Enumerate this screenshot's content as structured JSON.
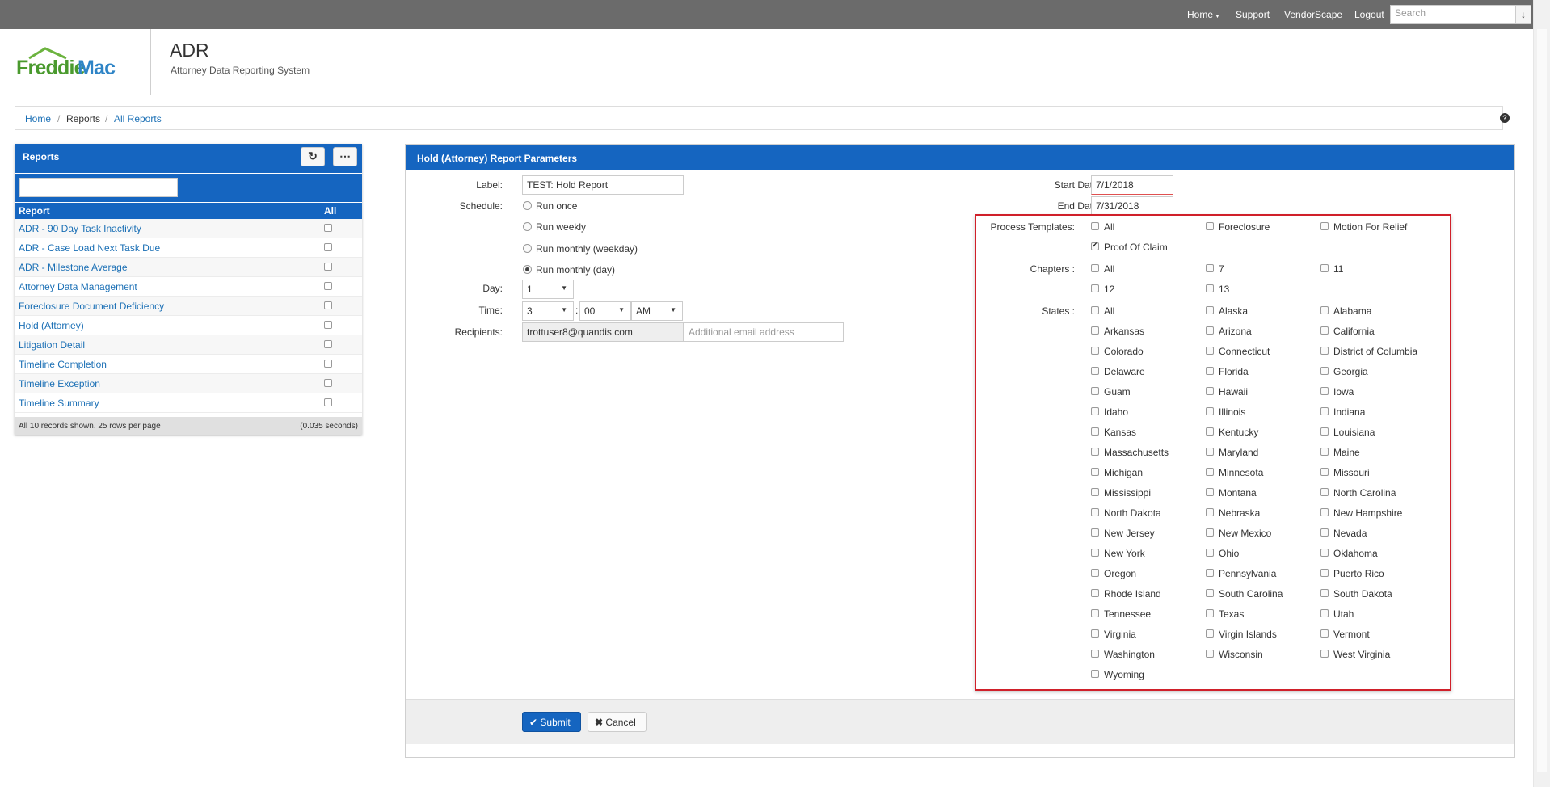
{
  "nav": {
    "items": [
      "Home",
      "Support",
      "VendorScape",
      "Logout"
    ],
    "search_placeholder": "Search"
  },
  "brand": {
    "word1": "Freddie",
    "word2": "Mac",
    "green": "#4a9a2e",
    "blue": "#2e84c6"
  },
  "app": {
    "title": "ADR",
    "subtitle": "Attorney Data Reporting System"
  },
  "breadcrumb": [
    "Home",
    "Reports",
    "All Reports"
  ],
  "reports": {
    "title": "Reports",
    "col_report": "Report",
    "col_all": "All",
    "rows": [
      "ADR - 90 Day Task Inactivity",
      "ADR - Case Load Next Task Due",
      "ADR - Milestone Average",
      "Attorney Data Management",
      "Foreclosure Document Deficiency",
      "Hold (Attorney)",
      "Litigation Detail",
      "Timeline Completion",
      "Timeline Exception",
      "Timeline Summary"
    ],
    "footer_left": "All 10 records shown. 25 rows per page",
    "footer_right": "(0.035 seconds)"
  },
  "params": {
    "title": "Hold (Attorney) Report Parameters",
    "label_lbl": "Label:",
    "label_value": "TEST: Hold Report",
    "schedule_lbl": "Schedule:",
    "schedule_options": [
      "Run once",
      "Run weekly",
      "Run monthly (weekday)",
      "Run monthly (day)"
    ],
    "schedule_selected": "Run monthly (day)",
    "day_lbl": "Day:",
    "day_value": "1",
    "time_lbl": "Time:",
    "time_hour": "3",
    "time_minute": "00",
    "time_ampm": "AM",
    "recipients_lbl": "Recipients:",
    "recipient_value": "trottuser8@quandis.com",
    "recipient_placeholder": "Additional email address",
    "start_lbl": "Start Date:",
    "start_value": "7/1/2018",
    "end_lbl": "End Date:",
    "end_value": "7/31/2018",
    "process_lbl": "Process Templates:",
    "process_options": [
      {
        "label": "All",
        "checked": false
      },
      {
        "label": "Foreclosure",
        "checked": false
      },
      {
        "label": "Motion For Relief",
        "checked": false
      },
      {
        "label": "Proof Of Claim",
        "checked": true
      }
    ],
    "chapters_lbl": "Chapters :",
    "chapter_options": [
      "All",
      "7",
      "11",
      "12",
      "13"
    ],
    "states_lbl": "States :",
    "states": [
      "All",
      "Alaska",
      "Alabama",
      "Arkansas",
      "Arizona",
      "California",
      "Colorado",
      "Connecticut",
      "District of Columbia",
      "Delaware",
      "Florida",
      "Georgia",
      "Guam",
      "Hawaii",
      "Iowa",
      "Idaho",
      "Illinois",
      "Indiana",
      "Kansas",
      "Kentucky",
      "Louisiana",
      "Massachusetts",
      "Maryland",
      "Maine",
      "Michigan",
      "Minnesota",
      "Missouri",
      "Mississippi",
      "Montana",
      "North Carolina",
      "North Dakota",
      "Nebraska",
      "New Hampshire",
      "New Jersey",
      "New Mexico",
      "Nevada",
      "New York",
      "Ohio",
      "Oklahoma",
      "Oregon",
      "Pennsylvania",
      "Puerto Rico",
      "Rhode Island",
      "South Carolina",
      "South Dakota",
      "Tennessee",
      "Texas",
      "Utah",
      "Virginia",
      "Virgin Islands",
      "Vermont",
      "Washington",
      "Wisconsin",
      "West Virginia",
      "Wyoming"
    ],
    "submit_label": "Submit",
    "cancel_label": "Cancel"
  },
  "colors": {
    "primary": "#1565c0",
    "topbar": "#6b6b6b",
    "highlight_border": "#d0202a"
  }
}
